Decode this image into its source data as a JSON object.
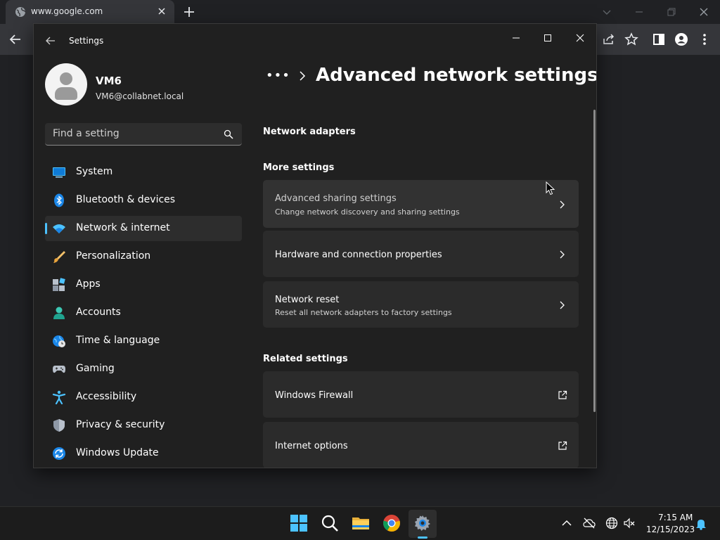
{
  "browser": {
    "tab_title": "www.google.com"
  },
  "settings": {
    "app_title": "Settings",
    "profile": {
      "name": "VM6",
      "email": "VM6@collabnet.local"
    },
    "search_placeholder": "Find a setting",
    "nav": [
      {
        "label": "System",
        "icon": "system-icon"
      },
      {
        "label": "Bluetooth & devices",
        "icon": "bluetooth-icon"
      },
      {
        "label": "Network & internet",
        "icon": "wifi-icon",
        "selected": true
      },
      {
        "label": "Personalization",
        "icon": "brush-icon"
      },
      {
        "label": "Apps",
        "icon": "apps-icon"
      },
      {
        "label": "Accounts",
        "icon": "accounts-icon"
      },
      {
        "label": "Time & language",
        "icon": "globe-clock-icon"
      },
      {
        "label": "Gaming",
        "icon": "gamepad-icon"
      },
      {
        "label": "Accessibility",
        "icon": "accessibility-icon"
      },
      {
        "label": "Privacy & security",
        "icon": "shield-icon"
      },
      {
        "label": "Windows Update",
        "icon": "update-icon"
      }
    ],
    "breadcrumb_more": "•••",
    "page_title": "Advanced network settings",
    "sections": {
      "network_adapters": "Network adapters",
      "more_settings": "More settings",
      "related_settings": "Related settings"
    },
    "cards": {
      "advanced_sharing": {
        "title": "Advanced sharing settings",
        "subtitle": "Change network discovery and sharing settings"
      },
      "hardware": {
        "title": "Hardware and connection properties"
      },
      "network_reset": {
        "title": "Network reset",
        "subtitle": "Reset all network adapters to factory settings"
      },
      "firewall": {
        "title": "Windows Firewall"
      },
      "internet_options": {
        "title": "Internet options"
      }
    }
  },
  "taskbar": {
    "time": "7:15 AM",
    "date": "12/15/2023"
  },
  "colors": {
    "accent": "#4cc2ff",
    "window_bg": "#202020",
    "card_bg": "#2b2b2b"
  }
}
